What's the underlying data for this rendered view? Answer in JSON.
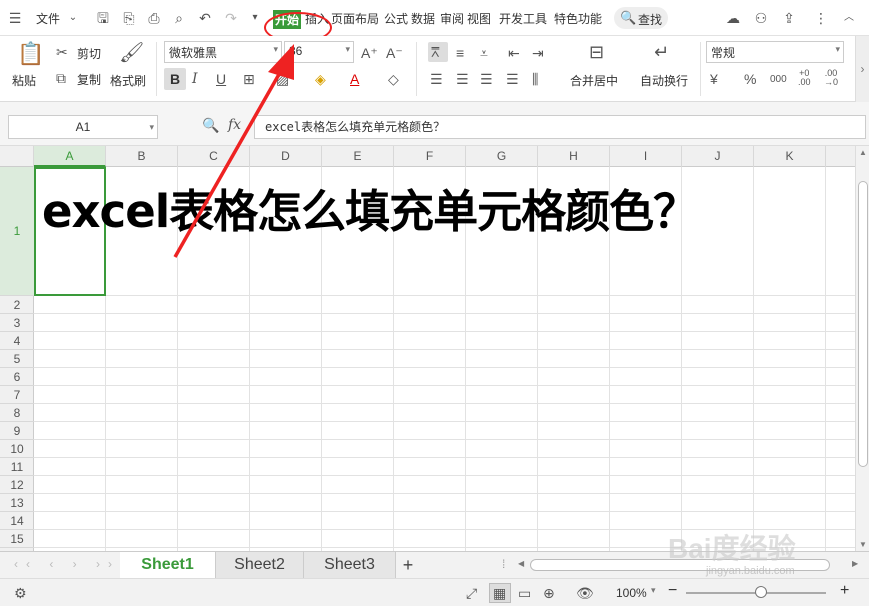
{
  "menubar": {
    "file_label": "文件",
    "tabs": [
      "开始",
      "插入",
      "页面布局",
      "公式",
      "数据",
      "审阅",
      "视图",
      "开发工具",
      "特色功能"
    ],
    "search_label": "查找"
  },
  "ribbon": {
    "paste": "粘贴",
    "cut": "剪切",
    "copy": "复制",
    "format_painter": "格式刷",
    "font_name": "微软雅黑",
    "font_size": "36",
    "merge_center": "合并居中",
    "wrap_text": "自动换行",
    "number_format": "常规",
    "bold": "B",
    "italic": "I",
    "underline": "U",
    "percent": "%",
    "thousands": "000"
  },
  "formula_bar": {
    "name_box": "A1",
    "fx": "fx",
    "formula": "excel表格怎么填充单元格颜色？"
  },
  "grid": {
    "columns": [
      "A",
      "B",
      "C",
      "D",
      "E",
      "F",
      "G",
      "H",
      "I",
      "J",
      "K"
    ],
    "rows": [
      "1",
      "2",
      "3",
      "4",
      "5",
      "6",
      "7",
      "8",
      "9",
      "10",
      "11",
      "12",
      "13",
      "14",
      "15"
    ],
    "cell_a1": "excel表格怎么填充单元格颜色？"
  },
  "sheets": [
    "Sheet1",
    "Sheet2",
    "Sheet3"
  ],
  "add_sheet": "+",
  "status": {
    "zoom": "100%",
    "zoom_minus": "−",
    "zoom_plus": "+"
  },
  "watermark": {
    "main": "Bai度经验",
    "sub": "jingyan.baidu.com"
  },
  "colors": {
    "accent_green": "#3a9a3a",
    "annotation_red": "#e22222"
  }
}
